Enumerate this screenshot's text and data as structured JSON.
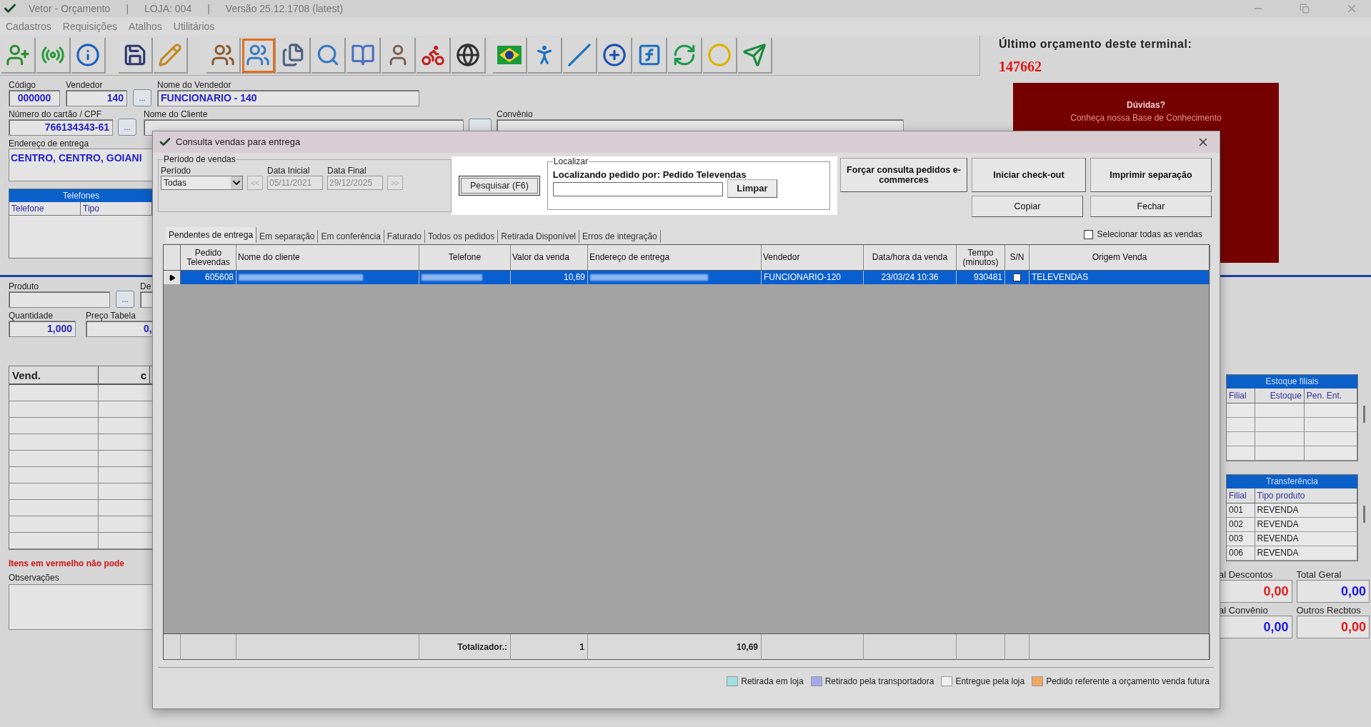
{
  "window": {
    "title_parts": [
      "Vetor - Orçamento",
      "|",
      "LOJA: 004",
      "|",
      "Versão 25.12.1708 (latest)"
    ]
  },
  "menu": [
    "Cadastros",
    "Requisições",
    "Atalhos",
    "Utilitários"
  ],
  "toolbar_groups": [
    [
      {
        "selected": false
      },
      {
        "selected": false
      },
      {
        "selected": false
      }
    ],
    [
      {
        "selected": false
      },
      {
        "selected": false
      }
    ],
    [
      {
        "selected": false
      },
      {
        "selected": true
      },
      {
        "selected": false
      },
      {
        "selected": false
      },
      {
        "selected": false
      },
      {
        "selected": false
      },
      {
        "selected": false
      },
      {
        "selected": false
      }
    ],
    [
      {
        "selected": false
      },
      {
        "selected": false
      },
      {
        "selected": false
      },
      {
        "selected": false
      },
      {
        "selected": false
      },
      {
        "selected": false
      },
      {
        "selected": false
      },
      {
        "selected": false
      }
    ]
  ],
  "form": {
    "codigo": {
      "label": "Código",
      "value": "000000"
    },
    "vendedor": {
      "label": "Vendedor",
      "value": "140"
    },
    "lookup": "...",
    "nome_vendedor": {
      "label": "Nome do Vendedor",
      "value": "FUNCIONARIO - 140"
    },
    "cpf": {
      "label": "Número do cartão / CPF",
      "value": "766134343-61"
    },
    "nome_cliente": {
      "label": "Nome do Cliente"
    },
    "convenio": {
      "label": "Convênio"
    },
    "endereco": {
      "label": "Endereço de entrega",
      "value": "CENTRO, CENTRO, GOIANI"
    }
  },
  "telefones": {
    "title": "Telefones",
    "columns": [
      "Telefone",
      "Tipo"
    ]
  },
  "last_quote": {
    "label": "Último orçamento deste terminal:",
    "value": "147662"
  },
  "help_banner": {
    "title": "Dúvidas?",
    "subtitle": "Conheça nossa Base de Conhecimento"
  },
  "product": {
    "produto_label": "Produto",
    "lookup": "...",
    "desc_label": "De",
    "quantidade_label": "Quantidade",
    "quantidade": "1,000",
    "preco_label": "Preço Tabela",
    "preco": "0,"
  },
  "items_table": {
    "columns": [
      "Vend.",
      "c"
    ]
  },
  "warning": "Itens em vermelho não pode",
  "observacoes_label": "Observações",
  "estoque": {
    "title": "Estoque filiais",
    "columns": [
      "Filial",
      "Estoque",
      "Pen. Ent."
    ]
  },
  "transferencia": {
    "title": "Transferência",
    "columns": [
      "Filial",
      "Tipo produto"
    ],
    "rows": [
      [
        "001",
        "REVENDA"
      ],
      [
        "002",
        "REVENDA"
      ],
      [
        "003",
        "REVENDA"
      ],
      [
        "006",
        "REVENDA"
      ]
    ]
  },
  "totals": [
    {
      "label": "al Descontos",
      "value": "0,00",
      "color": "#e01818"
    },
    {
      "label": "Total Geral",
      "value": "0,00",
      "color": "#1818e0"
    },
    {
      "label": "al Convênio",
      "value": "0,00",
      "color": "#1818e0"
    },
    {
      "label": "Outros Recbtos",
      "value": "0,00",
      "color": "#e01818"
    }
  ],
  "dialog": {
    "title": "Consulta vendas para entrega",
    "periodo": {
      "group": "Período de vendas",
      "periodo_label": "Período",
      "periodo_value": "Todas",
      "data_inicial_label": "Data Inicial",
      "data_inicial": "05/11/2021",
      "data_final_label": "Data Final",
      "data_final": "29/12/2025",
      "prev": "<<",
      "next": ">>"
    },
    "search_button": "Pesquisar (F6)",
    "localizar": {
      "group": "Localizar",
      "caption": "Localizando pedido por: Pedido Televendas",
      "clear": "Limpar"
    },
    "actions_top": [
      "Forçar consulta pedidos e-commerces",
      "Iniciar check-out",
      "Imprimir separação"
    ],
    "actions_bottom": [
      "Copiar",
      "Fechar"
    ],
    "tabs": [
      {
        "label": "Pendentes de entrega",
        "selected": true
      },
      {
        "label": "Em separação",
        "selected": false
      },
      {
        "label": "Em conferência",
        "selected": false
      },
      {
        "label": "Faturado",
        "selected": false
      },
      {
        "label": "Todos os pedidos",
        "selected": false
      },
      {
        "label": "Retirada Disponível",
        "selected": false
      },
      {
        "label": "Erros de integração",
        "selected": false
      }
    ],
    "select_all": {
      "label": "Selecionar todas as vendas",
      "checked": false
    },
    "grid": {
      "columns": [
        "Pedido Televendas",
        "Nome do cliente",
        "Telefone",
        "Valor da venda",
        "Endereço de entrega",
        "Vendedor",
        "Data/hora da venda",
        "Tempo (minutos)",
        "S/N",
        "Origem Venda"
      ],
      "rows": [
        {
          "selected": true,
          "cells": [
            {
              "kind": "text",
              "text": "605608"
            },
            {
              "kind": "redacted"
            },
            {
              "kind": "redacted"
            },
            {
              "kind": "text",
              "text": "10,69"
            },
            {
              "kind": "redacted"
            },
            {
              "kind": "text",
              "text": "FUNCIONARIO-120"
            },
            {
              "kind": "text",
              "text": "23/03/24 10:36"
            },
            {
              "kind": "text",
              "text": "930481"
            },
            {
              "kind": "checkbox",
              "checked": false
            },
            {
              "kind": "text",
              "text": "TELEVENDAS"
            }
          ]
        }
      ],
      "totals": {
        "label": "Totalizador.:",
        "count": "1",
        "value": "10,69"
      }
    },
    "legend": [
      {
        "label": "Retirada em loja",
        "color": "#a0e0e0"
      },
      {
        "label": "Retirado pela transportadora",
        "color": "#a8a8e8"
      },
      {
        "label": "Entregue pela loja",
        "color": "#f0f0f0"
      },
      {
        "label": "Pedido referente a orçamento venda futura",
        "color": "#f0a860"
      }
    ]
  }
}
